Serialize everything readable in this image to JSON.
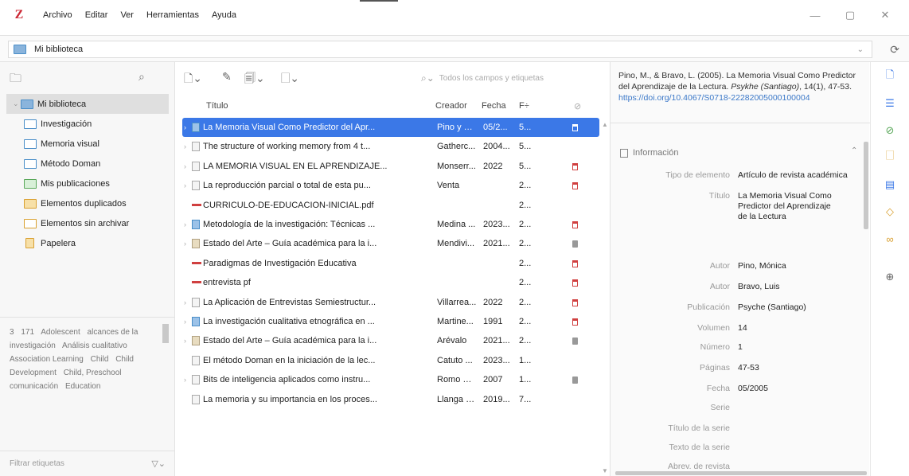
{
  "app": {
    "logo": "Z"
  },
  "menu": [
    "Archivo",
    "Editar",
    "Ver",
    "Herramientas",
    "Ayuda"
  ],
  "window": {
    "minimize": "—",
    "maximize": "▢",
    "close": "✕"
  },
  "library_selector": {
    "label": "Mi biblioteca"
  },
  "collections": [
    {
      "label": "Mi biblioteca",
      "type": "lib",
      "selected": true,
      "twisty": "⌄"
    },
    {
      "label": "Investigación",
      "type": "folder"
    },
    {
      "label": "Memoria visual",
      "type": "folder"
    },
    {
      "label": "Método Doman",
      "type": "folder"
    },
    {
      "label": "Mis publicaciones",
      "type": "pub"
    },
    {
      "label": "Elementos duplicados",
      "type": "dup"
    },
    {
      "label": "Elementos sin archivar",
      "type": "unf"
    },
    {
      "label": "Papelera",
      "type": "trash"
    }
  ],
  "tags": {
    "items": [
      "3",
      "171",
      "Adolescent",
      "alcances de la investigación",
      "Análisis cualitativo",
      "Association Learning",
      "Child",
      "Child Development",
      "Child, Preschool",
      "comunicación",
      "Education"
    ],
    "filter_placeholder": "Filtrar etiquetas"
  },
  "search": {
    "placeholder": "Todos los campos y etiquetas"
  },
  "columns": {
    "title": "Título",
    "creator": "Creador",
    "date": "Fecha",
    "f": "F÷"
  },
  "items": [
    {
      "title": "La Memoria Visual Como Predictor del Apr...",
      "creator": "Pino y B...",
      "date": "05/2...",
      "f": "5...",
      "icon": "book",
      "attach": "pdf",
      "selected": true,
      "twisty": "›"
    },
    {
      "title": "The structure of working memory from 4 t...",
      "creator": "Gatherc...",
      "date": "2004...",
      "f": "5...",
      "icon": "doc",
      "attach": "",
      "twisty": "›"
    },
    {
      "title": "LA MEMORIA VISUAL EN EL APRENDIZAJE...",
      "creator": "Monserr...",
      "date": "2022",
      "f": "5...",
      "icon": "doc",
      "attach": "pdf",
      "twisty": "›"
    },
    {
      "title": "La reproducción parcial o total de esta pu...",
      "creator": "Venta",
      "date": "",
      "f": "2...",
      "icon": "doc",
      "attach": "pdf",
      "twisty": "›"
    },
    {
      "title": "CURRICULO-DE-EDUCACION-INICIAL.pdf",
      "creator": "",
      "date": "",
      "f": "2...",
      "icon": "pdf",
      "attach": ""
    },
    {
      "title": "Metodología de la investigación: Técnicas ...",
      "creator": "Medina ...",
      "date": "2023...",
      "f": "2...",
      "icon": "book",
      "attach": "pdf",
      "twisty": "›"
    },
    {
      "title": "Estado del Arte – Guía académica para la i...",
      "creator": "Mendivi...",
      "date": "2021...",
      "f": "2...",
      "icon": "web",
      "attach": "snap",
      "twisty": "›"
    },
    {
      "title": "Paradigmas de Investigación Educativa",
      "creator": "",
      "date": "",
      "f": "2...",
      "icon": "pdf",
      "attach": "pdf"
    },
    {
      "title": "entrevista pf",
      "creator": "",
      "date": "",
      "f": "2...",
      "icon": "pdf",
      "attach": "pdf"
    },
    {
      "title": "La Aplicación de Entrevistas Semiestructur...",
      "creator": "Villarrea...",
      "date": "2022",
      "f": "2...",
      "icon": "doc",
      "attach": "pdf",
      "twisty": "›"
    },
    {
      "title": "La investigación cualitativa etnográfica en ...",
      "creator": "Martine...",
      "date": "1991",
      "f": "2...",
      "icon": "book",
      "attach": "pdf",
      "twisty": "›"
    },
    {
      "title": "Estado del Arte – Guía académica para la i...",
      "creator": "Arévalo",
      "date": "2021...",
      "f": "2...",
      "icon": "web",
      "attach": "snap",
      "twisty": "›"
    },
    {
      "title": "El método Doman en la iniciación de la lec...",
      "creator": "Catuto ...",
      "date": "2023...",
      "f": "1...",
      "icon": "doc",
      "attach": ""
    },
    {
      "title": "Bits de inteligencia aplicados como instru...",
      "creator": "Romo O...",
      "date": "2007",
      "f": "1...",
      "icon": "doc",
      "attach": "snap",
      "twisty": "›"
    },
    {
      "title": "La memoria y su importancia en los proces...",
      "creator": "Llanga e...",
      "date": "2019...",
      "f": "7...",
      "icon": "doc",
      "attach": ""
    }
  ],
  "citation": {
    "prefix": "Pino, M., & Bravo, L. (2005). La Memoria Visual Como Predictor del Aprendizaje de la Lectura. ",
    "journal": "Psykhe (Santiago)",
    "vol": ", 14",
    "issue": "(1), 47-53. ",
    "link": "https://doi.org/10.4067/S0718-22282005000100004"
  },
  "info": {
    "header": "Información",
    "fields": [
      {
        "label": "Tipo de elemento",
        "value": "Artículo de revista académica"
      },
      {
        "label": "Título",
        "value": "La Memoria Visual Como Predictor del Aprendizaje de la Lectura"
      },
      {
        "label": "Autor",
        "value": "Pino, Mónica"
      },
      {
        "label": "Autor",
        "value": "Bravo, Luis"
      },
      {
        "label": "Publicación",
        "value": "Psyche (Santiago)"
      },
      {
        "label": "Volumen",
        "value": "14"
      },
      {
        "label": "Número",
        "value": "1"
      },
      {
        "label": "Páginas",
        "value": "47-53"
      },
      {
        "label": "Fecha",
        "value": "05/2005"
      },
      {
        "label": "Serie",
        "value": ""
      },
      {
        "label": "Título de la serie",
        "value": ""
      },
      {
        "label": "Texto de la serie",
        "value": ""
      },
      {
        "label": "Abrev. de revista",
        "value": ""
      }
    ]
  },
  "colors": {
    "accent": "#3b78e7",
    "logo": "#cc2936"
  }
}
